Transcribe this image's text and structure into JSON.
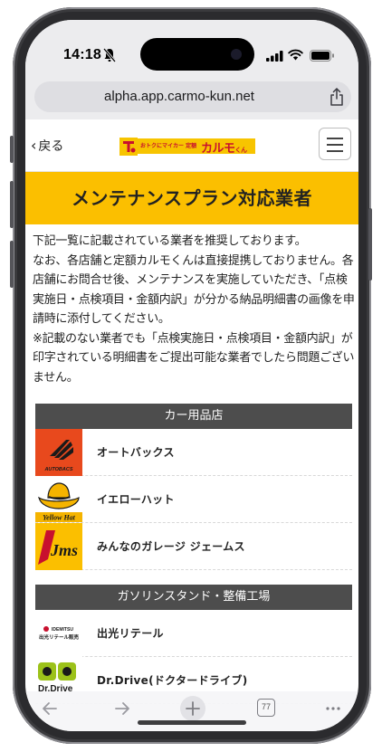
{
  "status_bar": {
    "time": "14:18"
  },
  "browser": {
    "url": "alpha.app.carmo-kun.net"
  },
  "header": {
    "back_label": "戻る",
    "logo_small": "おトクにマイカー 定額",
    "logo_big": "カルモ",
    "logo_kun": "くん"
  },
  "page": {
    "title": "メンテナンスプラン対応業者",
    "intro_lines": [
      "下記一覧に記載されている業者を推奨しております。",
      "なお、各店舗と定額カルモくんは直接提携しておりません。各店舗にお問合せ後、メンテナンスを実施していただき、「点検実施日・点検項目・金額内訳」が分かる納品明細書の画像を申請時に添付してください。",
      "※記載のない業者でも「点検実施日・点検項目・金額内訳」が印字されている明細書をご提出可能な業者でしたら問題ございません。"
    ]
  },
  "categories": [
    {
      "title": "カー用品店",
      "shops": [
        {
          "name": "オートバックス",
          "logo_text": "AUTOBACS"
        },
        {
          "name": "イエローハット",
          "logo_text": "Yellow Hat"
        },
        {
          "name": "みんなのガレージ ジェームス",
          "logo_text": "Jms"
        }
      ]
    },
    {
      "title": "ガソリンスタンド・整備工場",
      "shops": [
        {
          "name": "出光リテール",
          "logo_text": "出光リテール販売",
          "logo_top": "IDEMITSU"
        },
        {
          "name": "Dr.Drive(ドクタードライブ)",
          "logo_text": "Dr.Drive"
        }
      ]
    }
  ],
  "toolbar": {
    "tab_count": "77"
  },
  "colors": {
    "accent": "#fbbf00",
    "category_bg": "#4d4d4d",
    "logo_red": "#c8102e",
    "autobacs": "#e8491d"
  }
}
